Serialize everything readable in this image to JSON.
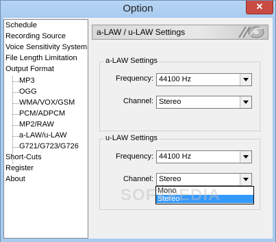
{
  "window": {
    "title": "Option",
    "close_glyph": "✕"
  },
  "tree": {
    "items": [
      {
        "label": "Schedule"
      },
      {
        "label": "Recording Source"
      },
      {
        "label": "Voice Sensitivity System"
      },
      {
        "label": "File Length Limitation"
      },
      {
        "label": "Output Format"
      },
      {
        "label": "MP3"
      },
      {
        "label": "OGG"
      },
      {
        "label": "WMA/VOX/GSM"
      },
      {
        "label": "PCM/ADPCM"
      },
      {
        "label": "MP2/RAW"
      },
      {
        "label": "a-LAW/u-LAW"
      },
      {
        "label": "G721/G723/G726"
      },
      {
        "label": "Short-Cuts"
      },
      {
        "label": "Register"
      },
      {
        "label": "About"
      }
    ],
    "selected": "a-LAW/u-LAW"
  },
  "panel": {
    "header": "a-LAW / u-LAW Settings",
    "alaw": {
      "title": "a-LAW Settings",
      "frequency_label": "Frequency:",
      "frequency_value": "44100 Hz",
      "channel_label": "Channel:",
      "channel_value": "Stereo"
    },
    "ulaw": {
      "title": "u-LAW Settings",
      "frequency_label": "Frequency:",
      "frequency_value": "44100 Hz",
      "channel_label": "Channel:",
      "channel_value": "Stereo",
      "dropdown_options": [
        "Mono",
        "Stereo"
      ],
      "dropdown_selected": "Stereo"
    }
  },
  "watermark": "SOFTPEDIA",
  "colors": {
    "titlebar": "#a8cbef",
    "close": "#c94c44",
    "selection": "#3399ff"
  }
}
